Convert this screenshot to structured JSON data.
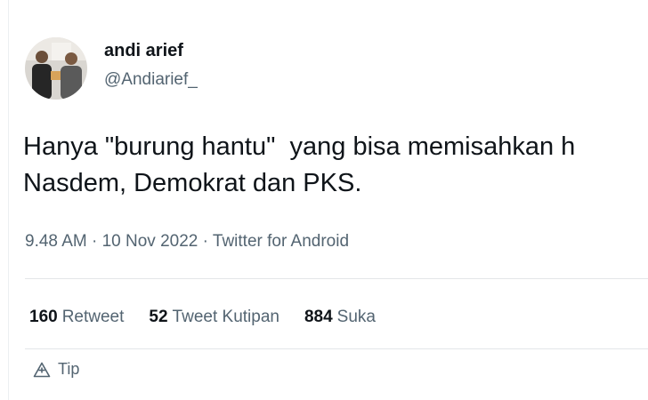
{
  "user": {
    "display_name": "andi arief",
    "handle": "@Andiarief_"
  },
  "tweet": {
    "text_lines": [
      "Hanya \"burung hantu\"  yang bisa memisahkan h",
      "Nasdem, Demokrat dan PKS."
    ],
    "meta": "9.48 AM · 10 Nov 2022 · Twitter for Android"
  },
  "stats": {
    "retweets": {
      "count": "160",
      "label": "Retweet"
    },
    "quotes": {
      "count": "52",
      "label": "Tweet Kutipan"
    },
    "likes": {
      "count": "884",
      "label": "Suka"
    }
  },
  "tip": {
    "label": "Tip",
    "icon": "tip-icon"
  },
  "colors": {
    "primary_text": "#0f1419",
    "secondary_text": "#536471",
    "divider": "#e3e6e8"
  }
}
